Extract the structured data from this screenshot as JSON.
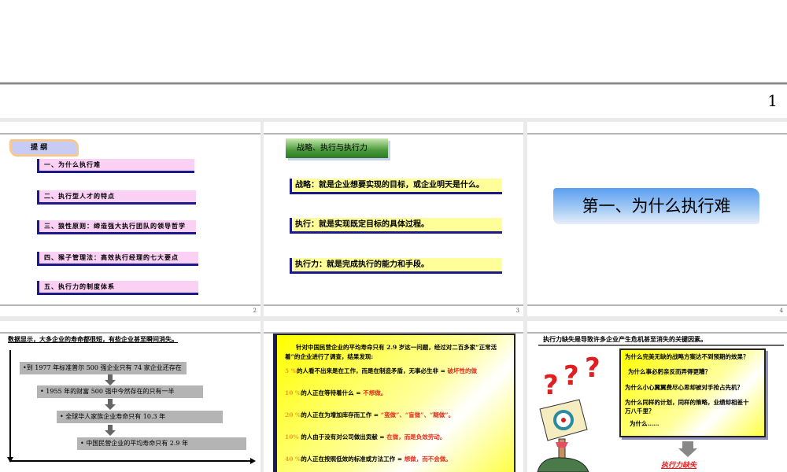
{
  "slide1": {
    "page_number": "1"
  },
  "slide2": {
    "page_number": "2",
    "title": "提  纲",
    "items": [
      "一、为什么执行难",
      "二、执行型人才的特点",
      "三、狼性原则：缔造强大执行团队的领导哲学",
      "四、猴子管理法：高效执行经理的七大要点",
      "五、执行力的制度体系"
    ]
  },
  "slide3": {
    "page_number": "3",
    "title": "战略、执行与执行力",
    "items": [
      "战略：就是企业想要实现的目标，或企业明天是什么。",
      "执行：就是实现既定目标的具体过程。",
      "执行力：就是完成执行的能力和手段。"
    ]
  },
  "slide4": {
    "page_number": "4",
    "title": "第一、为什么执行难"
  },
  "slide5": {
    "title": "数据显示，大多企业的寿命都很短，有些企业甚至瞬间消失。",
    "items": [
      "•到 1977 年标准普尔 500 强企业只有 74 家企业还存在",
      "• 1955 年的财富 500 强中今然存在的只有一半",
      "•  全球华人家族企业寿命只有 10.3 年",
      "•    中国民营企业的平均寿命只有 2.9 年"
    ]
  },
  "slide6": {
    "intro": "针对中国民营企业的平均寿命只有 2.9 岁这一问题，经过对二百多家“正常活着”的企业进行了调查，结果发现:",
    "rows": [
      {
        "pct": "5 %",
        "text": "的人看不出来是在工作，而是在制造矛盾，无事必生非 = ",
        "result": "破坏性的做"
      },
      {
        "pct": "10 %",
        "text": "的人正在等待着什么 = ",
        "result": "不想做。"
      },
      {
        "pct": "20 %",
        "text": "的人正在为增加库存而工作 = ",
        "result": "“蛮做”、“盲做”、“糊做”。"
      },
      {
        "pct": "10%",
        "text": " 的人由于没有对公司做出贡献 = ",
        "result": "在做，而是负效劳动。"
      },
      {
        "pct": "40 %",
        "text": "的人正在按照低效的标准或方法工作 = ",
        "result": "想做，而不会做。"
      }
    ],
    "colors": {
      "pct": "#f0a020",
      "result": "#e03020"
    }
  },
  "slide7": {
    "title": "执行力缺失是导致许多企业产生危机甚至消失的关键因素。",
    "questions": [
      "为什么完美无缺的战略方案达不到预期的效果？",
      "为什么事必躬亲反而弄得更糟？",
      "为什么小心翼翼费尽心思却被对手抢占先机？",
      "为什么同样的计划，同样的策略，业绩却相差十万八千里？",
      "为什么……"
    ],
    "question_marks": [
      "?",
      "?",
      "?"
    ],
    "conclusion": "执行力缺失"
  }
}
